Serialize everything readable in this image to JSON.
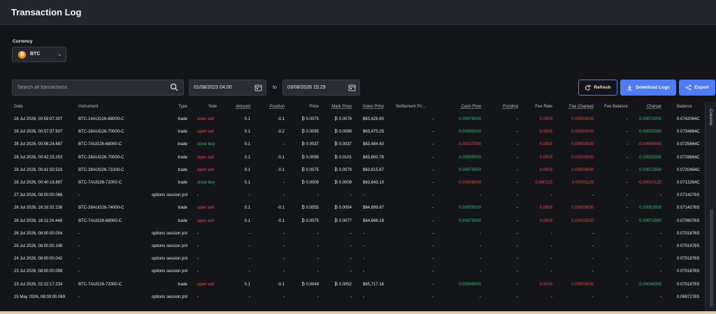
{
  "header": {
    "title": "Transaction Log"
  },
  "currency": {
    "label": "Currency",
    "value": "BTC",
    "coin_glyph": "₿"
  },
  "filters": {
    "search_placeholder": "Search all transactions",
    "date_from": "01/08/2023 04:00",
    "to_label": "to",
    "date_to": "03/08/2026 15:29"
  },
  "actions": {
    "refresh": "Refresh",
    "download": "Download Logs",
    "export": "Export"
  },
  "side_panel": {
    "columns_label": "Columns"
  },
  "table": {
    "headers": [
      "Date",
      "Instrument",
      "Type",
      "Side",
      "Amount",
      "Position",
      "Price",
      "Mark Price",
      "Index Price",
      "Settlement Pri...",
      "Cash Flow",
      "Funding",
      "Fee Rate",
      "Fee Charged",
      "Fee Balance",
      "Change",
      "Balance"
    ],
    "rows": [
      {
        "date": "28 Jul 2026, 00:59:07.307",
        "instrument": "BTC-14AUG26-68000-C",
        "type": "trade",
        "side": "open sell",
        "amount": "0.1",
        "position": "-0.1",
        "price": "₿ 0.0075",
        "mark": "₿ 0.0078",
        "index": "$63,426.60",
        "settle": "-",
        "cash": "0.00075000",
        "funding": "-",
        "fee_rate": "0.0003",
        "fee_charged": "0.00003000",
        "fee_balance": "-",
        "change": "0.00072000",
        "balance": "0.0742064C"
      },
      {
        "date": "28 Jul 2026, 00:57:37.507",
        "instrument": "BTC-28AUG26-70000-C",
        "type": "trade",
        "side": "open sell",
        "amount": "0.1",
        "position": "-0.2",
        "price": "₿ 0.0095",
        "mark": "₿ 0.0098",
        "index": "$63,475.25",
        "settle": "-",
        "cash": "0.00095000",
        "funding": "-",
        "fee_rate": "0.0003",
        "fee_charged": "0.00003000",
        "fee_balance": "-",
        "change": "0.00092000",
        "balance": "0.0734864C"
      },
      {
        "date": "28 Jul 2026, 00:56:24.687",
        "instrument": "BTC-7AUG26-68000-C",
        "type": "trade",
        "side": "close buy",
        "amount": "0.1",
        "position": "-",
        "price": "₿ 0.0037",
        "mark": "₿ 0.0037",
        "index": "$63,484.60",
        "settle": "-",
        "cash": "-0.00037000",
        "funding": "-",
        "fee_rate": "0.0003",
        "fee_charged": "0.00003000",
        "fee_balance": "-",
        "change": "-0.00040000",
        "balance": "0.0725664C"
      },
      {
        "date": "28 Jul 2026, 00:42:15.203",
        "instrument": "BTC-28AUG26-70000-C",
        "type": "trade",
        "side": "open sell",
        "amount": "0.1",
        "position": "-0.1",
        "price": "₿ 0.0095",
        "mark": "₿ 0.0101",
        "index": "$63,600.78",
        "settle": "-",
        "cash": "0.00095000",
        "funding": "-",
        "fee_rate": "0.0003",
        "fee_charged": "0.00003000",
        "fee_balance": "-",
        "change": "0.00092000",
        "balance": "0.0729664C"
      },
      {
        "date": "28 Jul 2026, 00:41:50.523",
        "instrument": "BTC-28AUG26-71000-C",
        "type": "trade",
        "side": "open sell",
        "amount": "0.1",
        "position": "-0.1",
        "price": "₿ 0.0075",
        "mark": "₿ 0.0079",
        "index": "$63,615.67",
        "settle": "-",
        "cash": "0.00075000",
        "funding": "-",
        "fee_rate": "0.0003",
        "fee_charged": "0.00003000",
        "fee_balance": "-",
        "change": "0.00072000",
        "balance": "0.0720464C"
      },
      {
        "date": "28 Jul 2026, 00:40:16.887",
        "instrument": "BTC-7AUG26-72000-C",
        "type": "trade",
        "side": "close buy",
        "amount": "0.1",
        "position": "-",
        "price": "₿ 0.0009",
        "mark": "₿ 0.0009",
        "index": "$63,643.10",
        "settle": "-",
        "cash": "-0.00009000",
        "funding": "-",
        "fee_rate": "0.000113",
        "fee_charged": "0.00001125",
        "fee_balance": "-",
        "change": "-0.00010125",
        "balance": "0.0713264C"
      },
      {
        "date": "27 Jul 2026, 08:00:00.066",
        "instrument": "-",
        "type": "options session pnl",
        "side": "-",
        "amount": "-",
        "position": "-",
        "price": "-",
        "mark": "-",
        "index": "-",
        "settle": "-",
        "cash": "-",
        "funding": "-",
        "fee_rate": "-",
        "fee_charged": "-",
        "fee_balance": "-",
        "change": "-",
        "balance": "0.0714276S"
      },
      {
        "date": "26 Jul 2026, 16:16:32.238",
        "instrument": "BTC-28AUG26-74000-C",
        "type": "trade",
        "side": "open sell",
        "amount": "0.1",
        "position": "-0.1",
        "price": "₿ 0.0055",
        "mark": "₿ 0.0054",
        "index": "$64,699.87",
        "settle": "-",
        "cash": "0.00055000",
        "funding": "-",
        "fee_rate": "0.0003",
        "fee_charged": "0.00003000",
        "fee_balance": "-",
        "change": "0.00052000",
        "balance": "0.0714276S"
      },
      {
        "date": "26 Jul 2026, 16:11:24.448",
        "instrument": "BTC-7AUG26-68000-C",
        "type": "trade",
        "side": "open sell",
        "amount": "0.1",
        "position": "-0.1",
        "price": "₿ 0.0075",
        "mark": "₿ 0.0077",
        "index": "$64,666.18",
        "settle": "-",
        "cash": "0.00075000",
        "funding": "-",
        "fee_rate": "0.0003",
        "fee_charged": "0.00003000",
        "fee_balance": "-",
        "change": "0.00072000",
        "balance": "0.0709076S"
      },
      {
        "date": "26 Jul 2026, 08:00:00.054",
        "instrument": "-",
        "type": "options session pnl",
        "side": "-",
        "amount": "-",
        "position": "-",
        "price": "-",
        "mark": "-",
        "index": "-",
        "settle": "-",
        "cash": "-",
        "funding": "-",
        "fee_rate": "-",
        "fee_charged": "-",
        "fee_balance": "-",
        "change": "-",
        "balance": "0.0701876S"
      },
      {
        "date": "25 Jul 2026, 08:00:00.148",
        "instrument": "-",
        "type": "options session pnl",
        "side": "-",
        "amount": "-",
        "position": "-",
        "price": "-",
        "mark": "-",
        "index": "-",
        "settle": "-",
        "cash": "-",
        "funding": "-",
        "fee_rate": "-",
        "fee_charged": "-",
        "fee_balance": "-",
        "change": "-",
        "balance": "0.0701876S"
      },
      {
        "date": "24 Jul 2026, 08:00:00.042",
        "instrument": "-",
        "type": "options session pnl",
        "side": "-",
        "amount": "-",
        "position": "-",
        "price": "-",
        "mark": "-",
        "index": "-",
        "settle": "-",
        "cash": "-",
        "funding": "-",
        "fee_rate": "-",
        "fee_charged": "-",
        "fee_balance": "-",
        "change": "-",
        "balance": "0.0701876S"
      },
      {
        "date": "23 Jul 2026, 08:00:00.098",
        "instrument": "-",
        "type": "options session pnl",
        "side": "-",
        "amount": "-",
        "position": "-",
        "price": "-",
        "mark": "-",
        "index": "-",
        "settle": "-",
        "cash": "-",
        "funding": "-",
        "fee_rate": "-",
        "fee_charged": "-",
        "fee_balance": "-",
        "change": "-",
        "balance": "0.0701876S"
      },
      {
        "date": "23 Jul 2026, 02:22:17.234",
        "instrument": "BTC-7AUG26-72000-C",
        "type": "trade",
        "side": "open sell",
        "amount": "0.1",
        "position": "-0.1",
        "price": "₿ 0.0049",
        "mark": "₿ 0.0052",
        "index": "$65,717.16",
        "settle": "-",
        "cash": "0.00049000",
        "funding": "-",
        "fee_rate": "0.0003",
        "fee_charged": "0.00003000",
        "fee_balance": "-",
        "change": "0.00046000",
        "balance": "0.0701876S"
      },
      {
        "date": "15 May 2026, 08:00:00.069",
        "instrument": "-",
        "type": "options session pnl",
        "side": "-",
        "amount": "-",
        "position": "-",
        "price": "-",
        "mark": "-",
        "index": "-",
        "settle": "-",
        "cash": "-",
        "funding": "-",
        "fee_rate": "-",
        "fee_charged": "-",
        "fee_balance": "-",
        "change": "-",
        "balance": "0.0697276S"
      }
    ]
  },
  "colors": {
    "accent": "#4d7cf5",
    "positive": "#2bbf77",
    "negative": "#e8474f",
    "bg": "#131519"
  }
}
